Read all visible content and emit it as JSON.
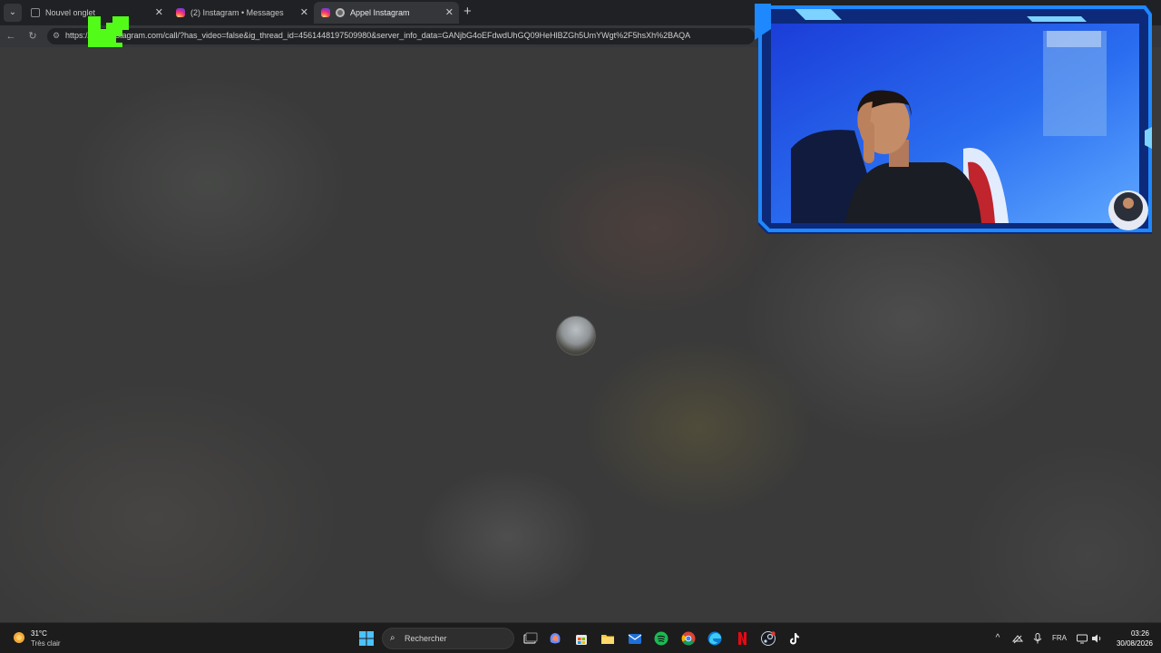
{
  "browser": {
    "tabs": [
      {
        "title": "Nouvel onglet",
        "active": false,
        "icon": "new-tab-page-icon"
      },
      {
        "title": "(2) Instagram • Messages",
        "active": false,
        "icon": "instagram-icon"
      },
      {
        "title": "Appel Instagram",
        "active": true,
        "icon": "recording-icon"
      }
    ],
    "close_glyph": "✕",
    "new_tab_glyph": "+",
    "address_bar": {
      "url": "https://www.instagram.com/call/?has_video=false&ig_thread_id=4561448197509980&server_info_data=GANjbG4oEFdwdUhGQ09HeHlBZGh5UmYWgt%2F5hsXh%2BAQA"
    }
  },
  "overlay": {
    "logo": "kick-logo"
  },
  "call": {
    "caller_avatar": "caller-avatar"
  },
  "taskbar": {
    "weather": {
      "temperature": "31°C",
      "condition": "Très clair"
    },
    "search_placeholder": "Rechercher",
    "search_icon": "⌕",
    "apps": [
      "task-view",
      "copilot",
      "store",
      "file-explorer",
      "mail",
      "spotify",
      "chrome",
      "edge",
      "netflix",
      "steam",
      "tiktok"
    ],
    "tray": {
      "chevron_glyph": "^",
      "language": "FRA",
      "time": "03:26",
      "date": "30/08/2026"
    }
  },
  "colors": {
    "kick_green": "#53fc18",
    "webcam_frame_blue": "#1e88ff",
    "browser_dark": "#202124"
  }
}
